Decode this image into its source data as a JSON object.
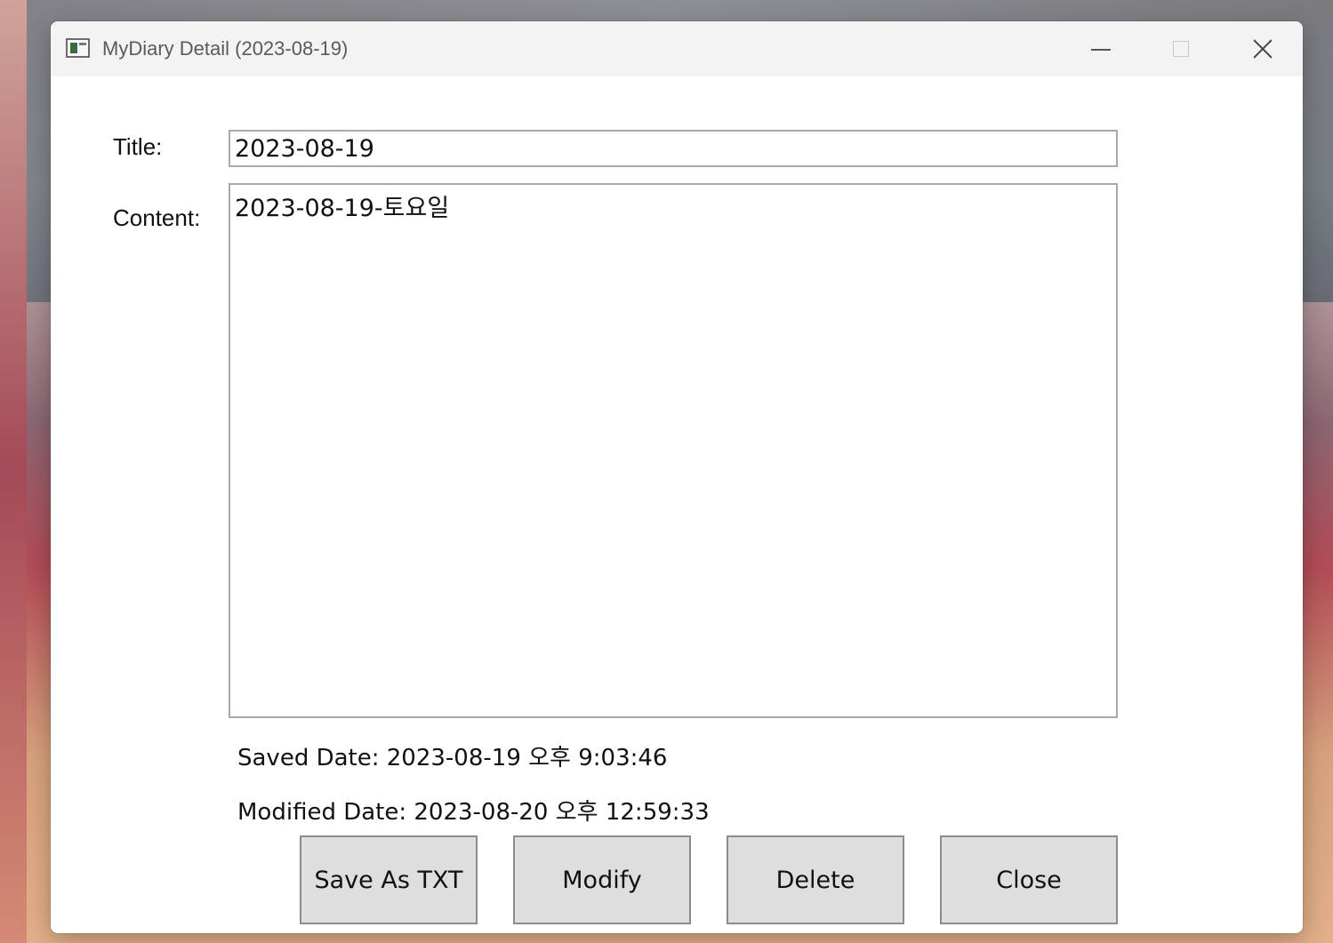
{
  "window": {
    "title": "MyDiary Detail (2023-08-19)",
    "icon": "app-window-icon",
    "controls": {
      "minimize_icon": "minimize-icon",
      "maximize_icon": "maximize-icon",
      "close_icon": "close-icon"
    }
  },
  "form": {
    "title_label": "Title:",
    "title_value": "2023-08-19",
    "content_label": "Content:",
    "content_value": "2023-08-19-토요일",
    "saved_date": "Saved Date: 2023-08-19 오후 9:03:46",
    "modified_date": "Modified Date: 2023-08-20 오후 12:59:33"
  },
  "buttons": {
    "save_as_txt": "Save As TXT",
    "modify": "Modify",
    "delete": "Delete",
    "close": "Close"
  }
}
